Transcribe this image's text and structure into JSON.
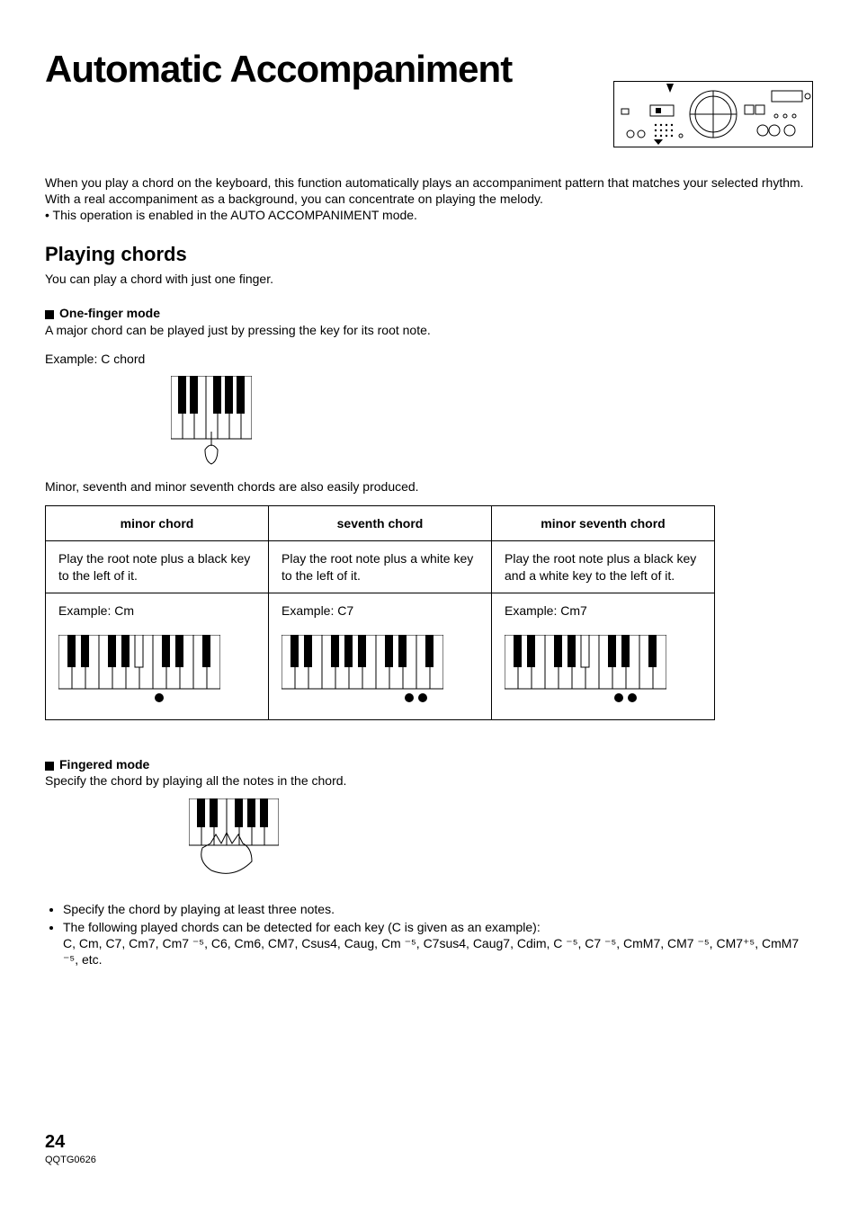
{
  "title": "Automatic Accompaniment",
  "intro": {
    "p1": "When you play a chord on the keyboard, this function automatically plays an accompaniment pattern that matches your selected rhythm. With a real accompaniment as a background, you can concentrate on playing the melody.",
    "bullet": "This operation is enabled in the AUTO ACCOMPANIMENT mode."
  },
  "section1": {
    "heading": "Playing chords",
    "lead": "You can play a chord with just one finger.",
    "mode1_title": "One-finger mode",
    "mode1_desc": "A major chord can be played just by pressing the key for its root note.",
    "mode1_example": "Example: C chord",
    "mode1_tail": "Minor, seventh and minor seventh chords are also easily produced."
  },
  "table": {
    "h1": "minor chord",
    "h2": "seventh chord",
    "h3": "minor seventh chord",
    "d1": "Play the root note plus a black key to the left of it.",
    "d2": "Play the root note plus a white key to the left of it.",
    "d3": "Play the root note plus a black key and a white key to the left of it.",
    "e1": "Example: Cm",
    "e2": "Example: C7",
    "e3": "Example: Cm7"
  },
  "section2": {
    "mode2_title": "Fingered mode",
    "mode2_desc": "Specify the chord by playing all the notes in the chord.",
    "b1": "Specify the chord by playing at least three notes.",
    "b2": "The following played chords can be detected for each key (C is given as an example):",
    "chordlist": "C, Cm, C7, Cm7, Cm7 ⁻⁵, C6, Cm6, CM7, Csus4, Caug, Cm ⁻⁵, C7sus4, Caug7, Cdim, C ⁻⁵, C7 ⁻⁵, CmM7, CM7 ⁻⁵, CM7⁺⁵, CmM7 ⁻⁵, etc."
  },
  "footer": {
    "page": "24",
    "docid": "QQTG0626"
  }
}
